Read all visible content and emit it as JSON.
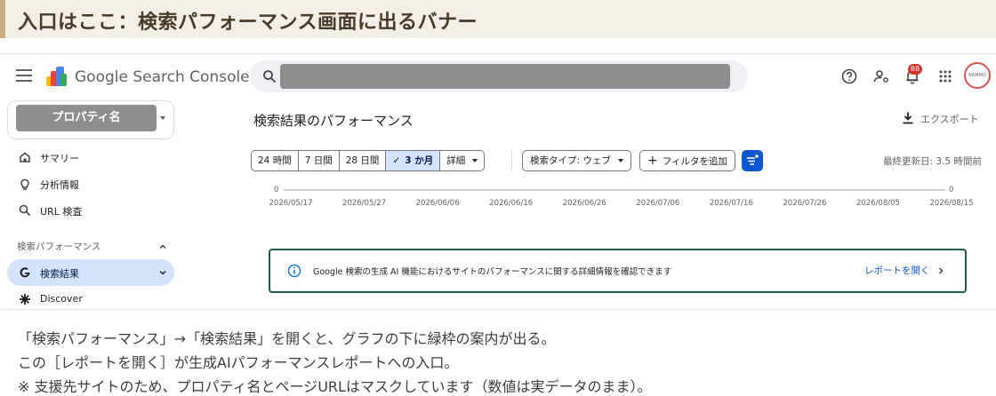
{
  "banner": {
    "title": "入口はここ：検索パフォーマンス画面に出るバナー"
  },
  "app": {
    "title": "Google Search Console"
  },
  "header": {
    "notifications_count": "88",
    "avatar_text": "NAMIKO"
  },
  "sidebar": {
    "property_label": "プロパティ名",
    "items": [
      {
        "label": "サマリー",
        "icon": "home-icon"
      },
      {
        "label": "分析情報",
        "icon": "lightbulb-icon"
      },
      {
        "label": "URL 検査",
        "icon": "search-icon"
      }
    ],
    "section": "検索パフォーマンス",
    "sub_items": [
      {
        "label": "検索結果",
        "icon": "google-g-icon",
        "active": true
      },
      {
        "label": "Discover",
        "icon": "asterisk-icon"
      }
    ]
  },
  "main": {
    "title": "検索結果のパフォーマンス",
    "export_label": "エクスポート",
    "date_ranges": [
      "24 時間",
      "7 日間",
      "28 日間",
      "3 か月",
      "詳細"
    ],
    "selected_range": "3 か月",
    "search_type": "検索タイプ: ウェブ",
    "add_filter": "フィルタを追加",
    "last_updated": "最終更新日: 3.5 時間前"
  },
  "chart_data": {
    "type": "line",
    "x": [
      "2026/05/17",
      "2026/05/27",
      "2026/06/06",
      "2026/06/16",
      "2026/06/26",
      "2026/07/06",
      "2026/07/16",
      "2026/07/26",
      "2026/08/05",
      "2026/08/15"
    ],
    "y_left_label": "0",
    "y_right_label": "0"
  },
  "notice": {
    "text": "Google 検索の生成 AI 機能におけるサイトのパフォーマンスに関する詳細情報を確認できます",
    "link": "レポートを開く"
  },
  "captions": [
    "「検索パフォーマンス」→「検索結果」を開くと、グラフの下に緑枠の案内が出る。",
    "この［レポートを開く］が生成AIパフォーマンスレポートへの入口。",
    "※ 支援先サイトのため、プロパティ名とページURLはマスクしています（数値は実データのまま）。"
  ],
  "colors": {
    "accent": "#0b57d0",
    "notice_border": "#1e5e48",
    "active_nav": "#d3e3fd",
    "banner_bg": "#f3efe6"
  }
}
